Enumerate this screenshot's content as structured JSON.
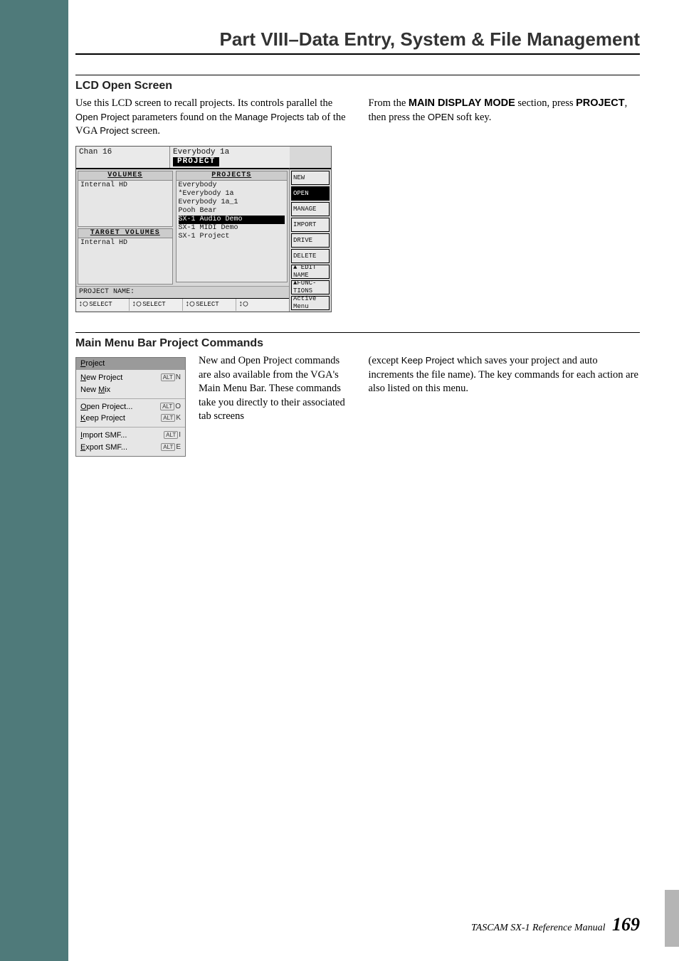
{
  "header": {
    "part_title": "Part VIII–Data Entry, System & File Management"
  },
  "section1": {
    "title": "LCD Open Screen",
    "left_para": "Use this LCD screen to recall projects. Its controls parallel the ",
    "left_para_ui1": "Open Project",
    "left_para_mid": " parameters found on the ",
    "left_para_ui2": "Manage Projects",
    "left_para_mid2": " tab of the VGA ",
    "left_para_ui3": "Project",
    "left_para_end": " screen.",
    "right_pre": "From the ",
    "right_b1": "MAIN DISPLAY MODE",
    "right_mid": " section, press ",
    "right_b2": "PROJECT",
    "right_mid2": ", then press the ",
    "right_ui": "OPEN",
    "right_end": " soft key."
  },
  "lcd": {
    "chan": "Chan 16",
    "title_project": "Everybody 1a",
    "tab": "PROJECT",
    "volumes_head": "VOLUMES",
    "volumes_item": "Internal HD",
    "target_head": "TARGET VOLUMES",
    "target_item": "Internal HD",
    "projects_head": "PROJECTS",
    "projects": [
      "Everybody",
      "*Everybody 1a",
      "Everybody 1a_1",
      "Pooh Bear",
      "SX-1 Audio Demo",
      "SX-1 MIDI Demo",
      "SX-1 Project"
    ],
    "projects_sel_index": 4,
    "proj_name_label": "PROJECT NAME:",
    "softkeys": [
      "NEW",
      "OPEN",
      "MANAGE",
      "IMPORT",
      "DRIVE",
      "DELETE",
      "▲ EDIT\nNAME",
      "▲FUNC-\nTIONS",
      "Active\nMenu"
    ],
    "soft_highlight_index": 1,
    "encoders": [
      "SELECT",
      "SELECT",
      "SELECT",
      ""
    ]
  },
  "section2": {
    "title": "Main Menu Bar Project Commands",
    "menu_title_pre": "P",
    "menu_title_rest": "roject",
    "groups": [
      [
        {
          "u": "N",
          "rest": "ew Project",
          "sc": "N"
        },
        {
          "pre": "New ",
          "u": "M",
          "rest": "ix",
          "sc": ""
        }
      ],
      [
        {
          "u": "O",
          "rest": "pen Project...",
          "sc": "O"
        },
        {
          "u": "K",
          "rest": "eep Project",
          "sc": "K"
        }
      ],
      [
        {
          "u": "I",
          "rest": "mport SMF...",
          "sc": "I"
        },
        {
          "u": "E",
          "rest": "xport SMF...",
          "sc": "E"
        }
      ]
    ],
    "mid_text": "New and Open Project commands are also available from the VGA's Main Menu Bar. These commands take you directly to their associated tab screens",
    "right_pre": "(except ",
    "right_ui": "Keep Project",
    "right_rest": " which saves your project and auto increments the file name). The key commands for each action are also listed on this menu."
  },
  "footer": {
    "book": "TASCAM SX-1 Reference Manual",
    "page": "169"
  }
}
